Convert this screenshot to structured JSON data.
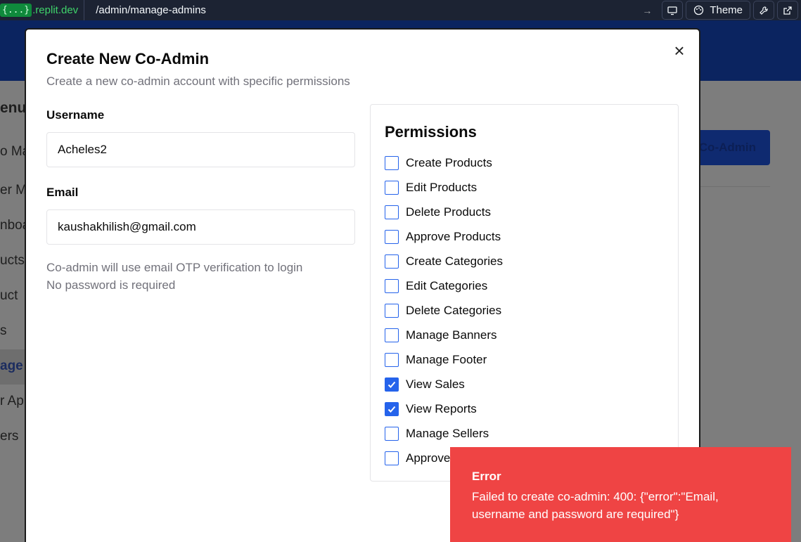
{
  "topbar": {
    "domain_brace": "{...}",
    "domain_suffix": ".replit.dev",
    "path": "/admin/manage-admins",
    "theme_label": "Theme",
    "icons": [
      "arrow-right-icon",
      "monitor-icon",
      "palette-icon",
      "wrench-icon",
      "external-link-icon"
    ]
  },
  "background": {
    "sidebar_fragments": [
      "enu",
      "o Ma",
      "er M",
      "nboa",
      "ucts",
      "uct",
      "s",
      "age",
      "r Ap",
      "ers"
    ],
    "button_fragment": "Co-Admin"
  },
  "modal": {
    "title": "Create New Co-Admin",
    "subtitle": "Create a new co-admin account with specific permissions",
    "username_label": "Username",
    "username_value": "Acheles2",
    "email_label": "Email",
    "email_value": "kaushakhilish@gmail.com",
    "hint_line1": "Co-admin will use email OTP verification to login",
    "hint_line2": "No password is required",
    "permissions_title": "Permissions",
    "permissions": [
      {
        "label": "Create Products",
        "checked": false
      },
      {
        "label": "Edit Products",
        "checked": false
      },
      {
        "label": "Delete Products",
        "checked": false
      },
      {
        "label": "Approve Products",
        "checked": false
      },
      {
        "label": "Create Categories",
        "checked": false
      },
      {
        "label": "Edit Categories",
        "checked": false
      },
      {
        "label": "Delete Categories",
        "checked": false
      },
      {
        "label": "Manage Banners",
        "checked": false
      },
      {
        "label": "Manage Footer",
        "checked": false
      },
      {
        "label": "View Sales",
        "checked": true
      },
      {
        "label": "View Reports",
        "checked": true
      },
      {
        "label": "Manage Sellers",
        "checked": false
      },
      {
        "label": "Approve",
        "checked": false
      }
    ]
  },
  "toast": {
    "title": "Error",
    "message": "Failed to create co-admin: 400: {\"error\":\"Email, username and password are required\"}"
  },
  "colors": {
    "accent": "#2563eb",
    "toast_bg": "#ef4444",
    "header_bg": "#0b2460",
    "topbar_bg": "#1c2333"
  }
}
